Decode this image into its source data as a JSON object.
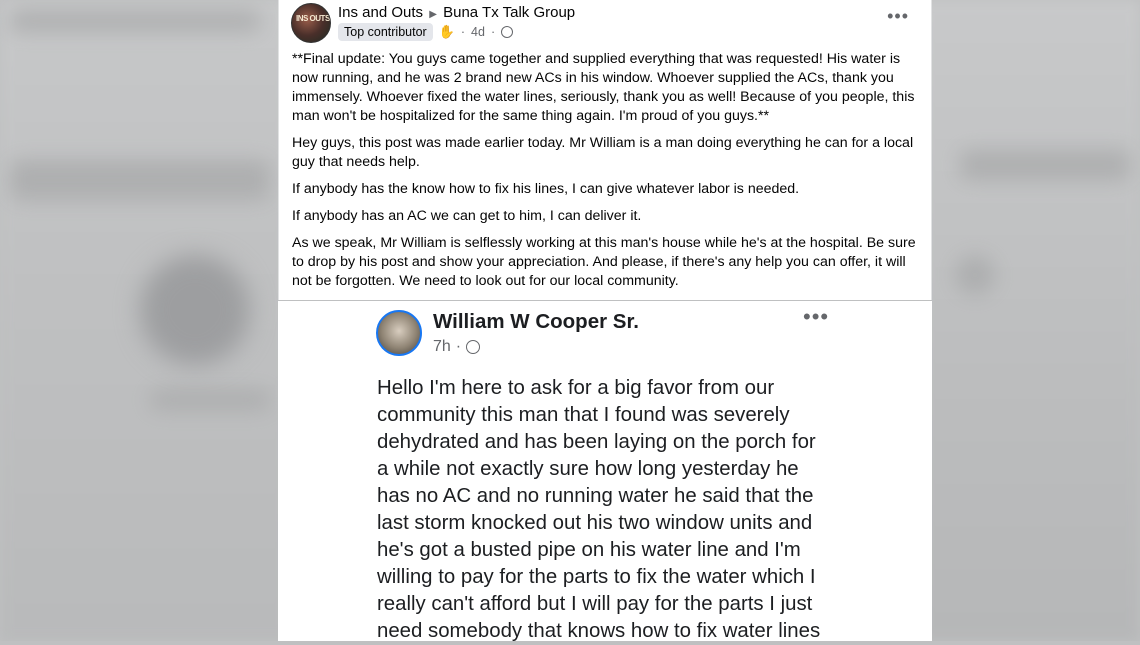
{
  "post": {
    "author": "Ins and Outs",
    "group": "Buna Tx Talk Group",
    "badge": "Top contributor",
    "time": "4d",
    "paragraphs": [
      "**Final update: You guys came together and supplied everything that was requested! His water is now running, and he was 2 brand new ACs in his window. Whoever supplied the ACs, thank you immensely. Whoever fixed the water lines, seriously, thank you as well! Because of you people, this man won't be hospitalized for the same thing again. I'm proud of you guys.**",
      "Hey guys, this post was made earlier today. Mr William is a man doing everything he can for a local guy that needs help.",
      "If anybody has the know how to fix his lines, I can give whatever labor is needed.",
      "If anybody has an AC we can get to him, I can deliver it.",
      "As we speak, Mr William is selflessly working at this man's house while he's at the hospital. Be sure to drop by his post and show your appreciation. And please, if there's any help you can offer, it will not be forgotten. We need to look out for our local community."
    ]
  },
  "shared": {
    "author": "William W Cooper Sr.",
    "time": "7h",
    "lines": [
      "Hello I'm here to ask for a big favor from our",
      "community this man that I found was severely",
      "dehydrated and has been laying on the porch for",
      "a while not exactly sure how long yesterday he",
      "has no AC and no running water he said that the",
      "last storm knocked out his two window units and",
      "he's got a busted pipe on his water line and I'm",
      "willing to pay for the parts to fix the water which I",
      "really can't afford but I will pay for the parts I just",
      "need somebody that knows how to fix water lines"
    ]
  },
  "icons": {
    "more": "more-options-icon",
    "globe": "globe-icon",
    "contributor": "hand-icon"
  }
}
